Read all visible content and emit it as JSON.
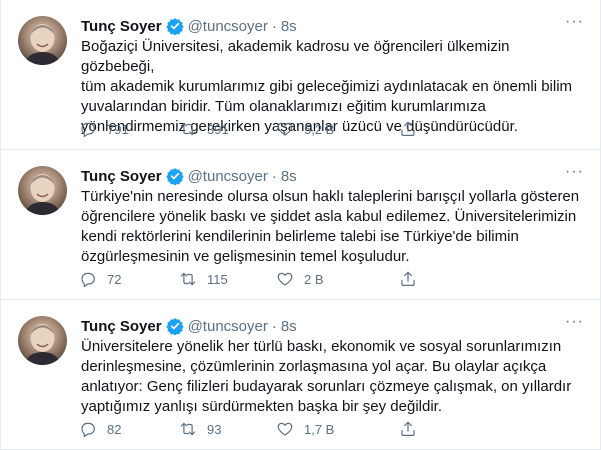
{
  "colors": {
    "text": "#0f1419",
    "secondary": "#5b7083",
    "verified": "#1da1f2",
    "divider": "#e6ecf0"
  },
  "tweets": [
    {
      "name": "Tunç Soyer",
      "handle": "@tuncsoyer",
      "dot": "·",
      "time": "8s",
      "more": "···",
      "text": "Boğaziçi Üniversitesi, akademik kadrosu ve öğrencileri ülkemizin gözbebeği,\ntüm akademik kurumlarımız gibi geleceğimizi aydınlatacak en önemli bilim\nyuvalarından biridir. Tüm olanaklarımızı eğitim kurumlarımıza\nyönlendirmemiz gerekirken yaşananlar üzücü ve düşündürücüdür.",
      "replies": "791",
      "retweets": "391",
      "likes": "5,2 B"
    },
    {
      "name": "Tunç Soyer",
      "handle": "@tuncsoyer",
      "dot": "·",
      "time": "8s",
      "more": "···",
      "text": "Türkiye'nin neresinde olursa olsun haklı taleplerini barışçıl yollarla gösteren\nöğrencilere yönelik baskı ve şiddet asla kabul edilemez. Üniversitelerimizin\nkendi rektörlerini kendilerinin belirleme talebi ise Türkiye'de bilimin\nözgürleşmesinin ve gelişmesinin temel koşuludur.",
      "replies": "72",
      "retweets": "115",
      "likes": "2 B"
    },
    {
      "name": "Tunç Soyer",
      "handle": "@tuncsoyer",
      "dot": "·",
      "time": "8s",
      "more": "···",
      "text": "Üniversitelere yönelik her türlü baskı, ekonomik ve sosyal sorunlarımızın\nderinleşmesine, çözümlerinin zorlaşmasına yol açar. Bu olaylar açıkça\nanlatıyor: Genç filizleri budayarak sorunları çözmeye çalışmak, on yıllardır\nyaptığımız yanlışı sürdürmekten başka bir şey değildir.",
      "replies": "82",
      "retweets": "93",
      "likes": "1,7 B"
    }
  ]
}
